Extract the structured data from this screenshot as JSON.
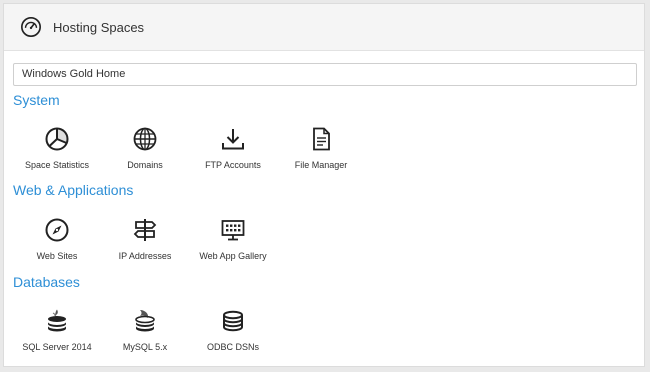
{
  "header": {
    "title": "Hosting Spaces",
    "icon": "speedometer-icon"
  },
  "space_selector": {
    "value": "Windows Gold Home"
  },
  "sections": [
    {
      "title": "System",
      "items": [
        {
          "label": "Space Statistics",
          "icon": "pie-chart-icon"
        },
        {
          "label": "Domains",
          "icon": "globe-icon"
        },
        {
          "label": "FTP Accounts",
          "icon": "download-tray-icon"
        },
        {
          "label": "File Manager",
          "icon": "document-icon"
        }
      ]
    },
    {
      "title": "Web & Applications",
      "items": [
        {
          "label": "Web Sites",
          "icon": "compass-icon"
        },
        {
          "label": "IP Addresses",
          "icon": "signpost-icon"
        },
        {
          "label": "Web App Gallery",
          "icon": "monitor-grid-icon"
        }
      ]
    },
    {
      "title": "Databases",
      "items": [
        {
          "label": "SQL Server 2014",
          "icon": "sql-server-database-icon"
        },
        {
          "label": "MySQL 5.x",
          "icon": "mysql-dolphin-database-icon"
        },
        {
          "label": "ODBC DSNs",
          "icon": "database-stack-icon"
        }
      ]
    }
  ],
  "colors": {
    "accent": "#2e8fd6",
    "header_bg": "#f5f5f5",
    "text": "#333333"
  }
}
